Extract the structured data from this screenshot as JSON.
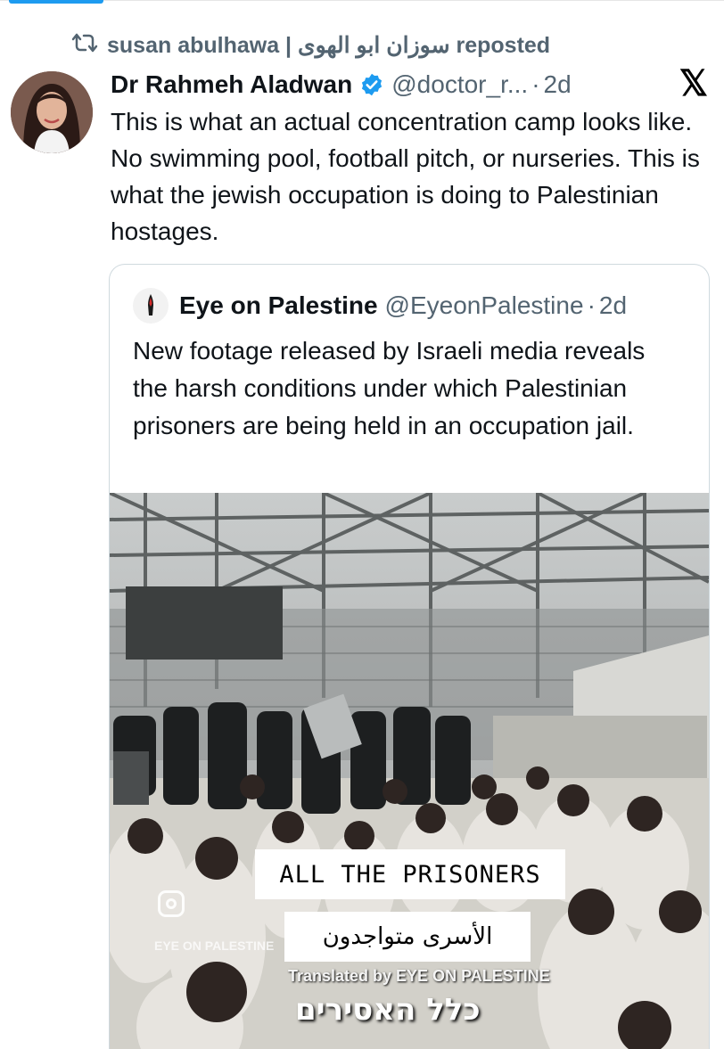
{
  "repost": {
    "label": "susan abulhawa | سوزان ابو الهوى reposted",
    "icon": "repost-icon"
  },
  "post": {
    "author_name": "Dr Rahmeh Aladwan",
    "handle": "@doctor_r...",
    "separator": "·",
    "time": "2d",
    "verified_color": "#1d9bf0",
    "platform_logo": "𝕏",
    "text": "This is what an actual concentration camp looks like. No swimming pool, football pitch, or nurseries. This is what the jewish occupation is doing to Palestinian hostages."
  },
  "quote": {
    "author_name": "Eye on Palestine",
    "handle": "@EyeonPalestine",
    "separator": "·",
    "time": "2d",
    "text": "New footage released by Israeli media reveals the harsh conditions under which Palestinian prisoners are being held in an occupation jail.",
    "media": {
      "caption_en": "ALL THE PRISONERS",
      "caption_ar": "الأسرى متواجدون",
      "translated_by": "Translated by EYE ON PALESTINE",
      "caption_he": "כלל האסירים",
      "watermark": "EYE ON PALESTINE"
    }
  }
}
